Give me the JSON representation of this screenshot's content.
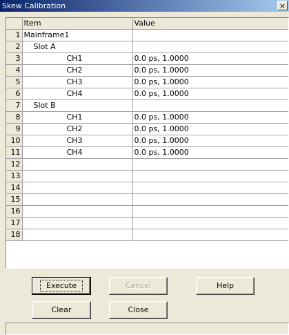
{
  "window": {
    "title": "Skew Calibration",
    "close_glyph": "×"
  },
  "grid": {
    "headers": {
      "item": "Item",
      "value": "Value"
    },
    "rows": [
      {
        "num": "1",
        "item": "Mainframe1",
        "level": 0,
        "value": ""
      },
      {
        "num": "2",
        "item": "Slot A",
        "level": 1,
        "value": ""
      },
      {
        "num": "3",
        "item": "CH1",
        "level": 2,
        "value": "0.0 ps, 1.0000"
      },
      {
        "num": "4",
        "item": "CH2",
        "level": 2,
        "value": "0.0 ps, 1.0000"
      },
      {
        "num": "5",
        "item": "CH3",
        "level": 2,
        "value": "0.0 ps, 1.0000"
      },
      {
        "num": "6",
        "item": "CH4",
        "level": 2,
        "value": "0.0 ps, 1.0000"
      },
      {
        "num": "7",
        "item": "Slot B",
        "level": 1,
        "value": ""
      },
      {
        "num": "8",
        "item": "CH1",
        "level": 2,
        "value": "0.0 ps, 1.0000"
      },
      {
        "num": "9",
        "item": "CH2",
        "level": 2,
        "value": "0.0 ps, 1.0000"
      },
      {
        "num": "10",
        "item": "CH3",
        "level": 2,
        "value": "0.0 ps, 1.0000"
      },
      {
        "num": "11",
        "item": "CH4",
        "level": 2,
        "value": "0.0 ps, 1.0000"
      },
      {
        "num": "12",
        "item": "",
        "level": 0,
        "value": ""
      },
      {
        "num": "13",
        "item": "",
        "level": 0,
        "value": ""
      },
      {
        "num": "14",
        "item": "",
        "level": 0,
        "value": ""
      },
      {
        "num": "15",
        "item": "",
        "level": 0,
        "value": ""
      },
      {
        "num": "16",
        "item": "",
        "level": 0,
        "value": ""
      },
      {
        "num": "17",
        "item": "",
        "level": 0,
        "value": ""
      },
      {
        "num": "18",
        "item": "",
        "level": 0,
        "value": ""
      }
    ]
  },
  "buttons": {
    "execute": "Execute",
    "cancel": "Cancel",
    "help": "Help",
    "clear": "Clear",
    "close": "Close"
  },
  "status": {
    "text": ""
  }
}
